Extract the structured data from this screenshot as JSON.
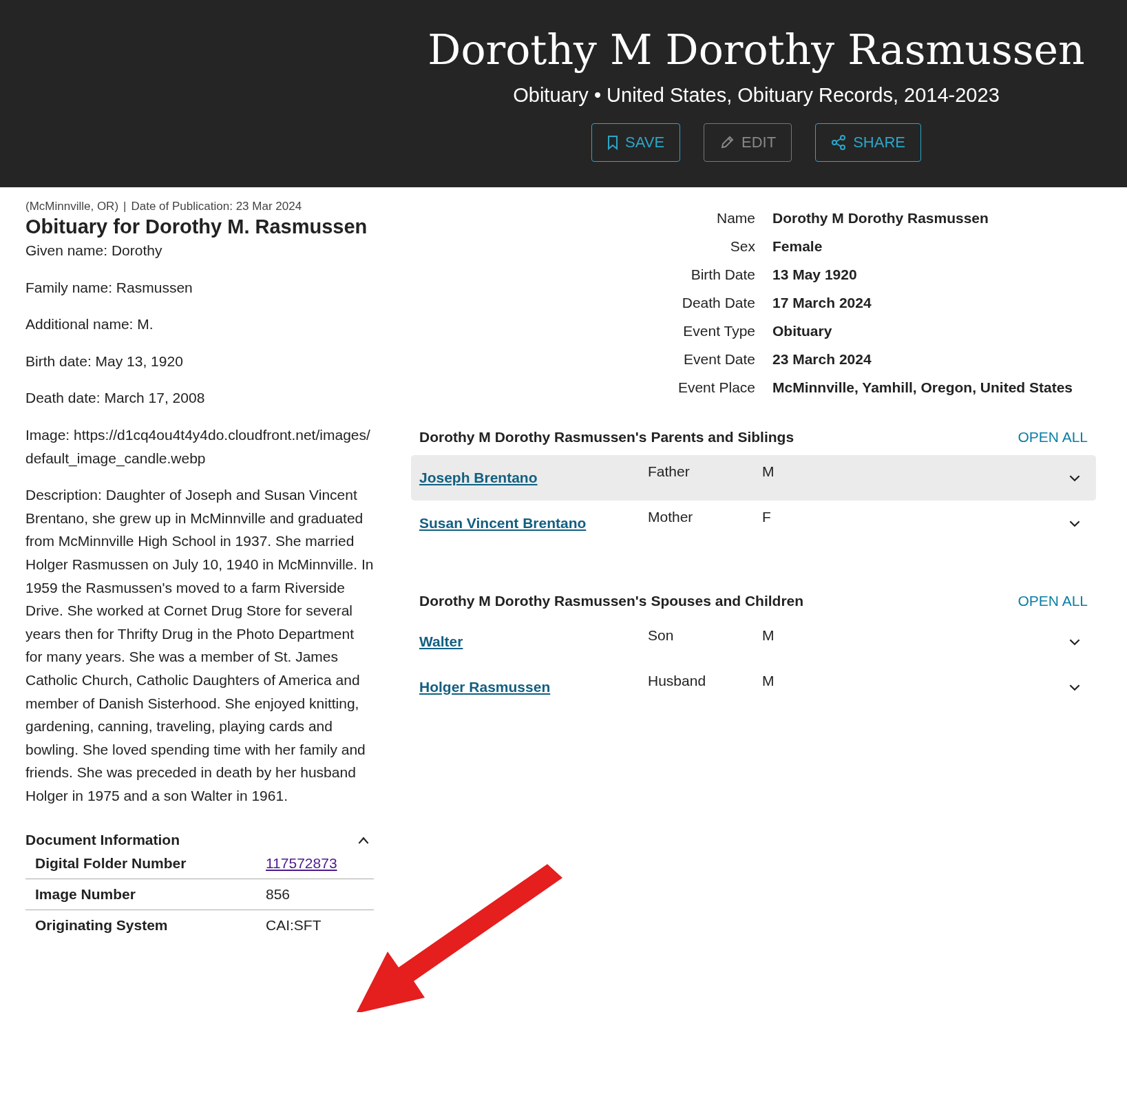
{
  "header": {
    "title": "Dorothy M Dorothy Rasmussen",
    "subtitle": "Obituary • United States, Obituary Records, 2014-2023",
    "buttons": [
      {
        "kind": "save",
        "label": "SAVE",
        "disabled": false
      },
      {
        "kind": "edit",
        "label": "EDIT",
        "disabled": true
      },
      {
        "kind": "share",
        "label": "SHARE",
        "disabled": false
      }
    ]
  },
  "record": {
    "source": "(McMinnville, OR)",
    "separator": "|",
    "publication": "Date of Publication: 23 Mar 2024",
    "heading": "Obituary for Dorothy M. Rasmussen",
    "paragraphs": [
      "Given name: Dorothy",
      "Family name: Rasmussen",
      "Additional name: M.",
      "Birth date: May 13, 1920",
      "Death date: March 17, 2008",
      "Image: https://d1cq4ou4t4y4do.cloudfront.net/images/default_image_candle.webp",
      "Description: Daughter of Joseph and Susan Vincent Brentano, she grew up in McMinnville and graduated from McMinnville High School in 1937. She married Holger Rasmussen on July 10, 1940 in McMinnville. In 1959 the Rasmussen's moved to a farm Riverside Drive. She worked at Cornet Drug Store for several years then for Thrifty Drug in the Photo Department for many years. She was a member of St. James Catholic Church, Catholic Daughters of America and member of Danish Sisterhood. She enjoyed knitting, gardening, canning, traveling, playing cards and bowling. She loved spending time with her family and friends. She was preceded in death by her husband Holger in 1975 and a son Walter in 1961."
    ]
  },
  "document_info": {
    "title": "Document Information",
    "expanded": true,
    "rows": [
      {
        "label": "Digital Folder Number",
        "value": "117572873",
        "kind": "link"
      },
      {
        "label": "Image Number",
        "value": "856",
        "kind": "text"
      },
      {
        "label": "Originating System",
        "value": "CAI:SFT",
        "kind": "text"
      }
    ]
  },
  "facts": [
    {
      "label": "Name",
      "value": "Dorothy M Dorothy Rasmussen"
    },
    {
      "label": "Sex",
      "value": "Female"
    },
    {
      "label": "Birth Date",
      "value": "13 May 1920"
    },
    {
      "label": "Death Date",
      "value": "17 March 2024"
    },
    {
      "label": "Event Type",
      "value": "Obituary"
    },
    {
      "label": "Event Date",
      "value": "23 March 2024"
    },
    {
      "label": "Event Place",
      "value": "McMinnville, Yamhill, Oregon, United States"
    }
  ],
  "relations": [
    {
      "title": "Dorothy M Dorothy Rasmussen's Parents and Siblings",
      "action": "OPEN ALL",
      "people": [
        {
          "name": "Joseph Brentano",
          "relation": "Father",
          "sex": "M",
          "selected": true,
          "expanded": false
        },
        {
          "name": "Susan Vincent Brentano",
          "relation": "Mother",
          "sex": "F",
          "selected": false,
          "expanded": false
        }
      ]
    },
    {
      "title": "Dorothy M Dorothy Rasmussen's Spouses and Children",
      "action": "OPEN ALL",
      "people": [
        {
          "name": "Walter",
          "relation": "Son",
          "sex": "M",
          "selected": false,
          "expanded": false
        },
        {
          "name": "Holger Rasmussen",
          "relation": "Husband",
          "sex": "M",
          "selected": false,
          "expanded": false
        }
      ]
    }
  ]
}
